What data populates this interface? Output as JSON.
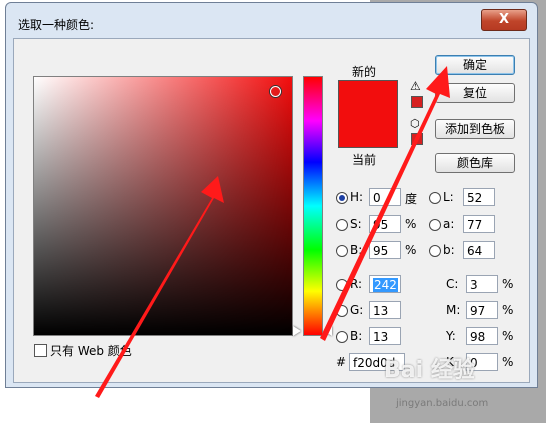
{
  "window": {
    "title": "选取一种颜色:",
    "close_glyph": "X"
  },
  "picker": {
    "new_label": "新的",
    "current_label": "当前",
    "new_color": "#f20d0d",
    "current_color": "#f20d0d",
    "warning_glyph": "⚠",
    "cube_glyph": "⬡",
    "web_only_label": "只有 Web 颜色"
  },
  "buttons": {
    "ok": "确定",
    "reset": "复位",
    "add_swatch": "添加到色板",
    "libraries": "颜色库"
  },
  "hsb": {
    "h_label": "H:",
    "h_value": "0",
    "h_unit": "度",
    "s_label": "S:",
    "s_value": "95",
    "s_unit": "%",
    "b_label": "B:",
    "b_value": "95",
    "b_unit": "%"
  },
  "lab": {
    "l_label": "L:",
    "l_value": "52",
    "a_label": "a:",
    "a_value": "77",
    "b_label": "b:",
    "b_value": "64"
  },
  "rgb": {
    "r_label": "R:",
    "r_value": "242",
    "g_label": "G:",
    "g_value": "13",
    "b_label": "B:",
    "b_value": "13"
  },
  "cmyk": {
    "c_label": "C:",
    "c_value": "3",
    "m_label": "M:",
    "m_value": "97",
    "y_label": "Y:",
    "y_value": "98",
    "k_label": "K:",
    "k_value": "0",
    "unit": "%"
  },
  "hex": {
    "label": "#",
    "value": "f20d0d"
  },
  "watermark": {
    "text": "Bai 经验",
    "url": "jingyan.baidu.com"
  },
  "colors": {
    "annotation_arrow": "#ff1a1a",
    "selection": "#3399ff"
  }
}
